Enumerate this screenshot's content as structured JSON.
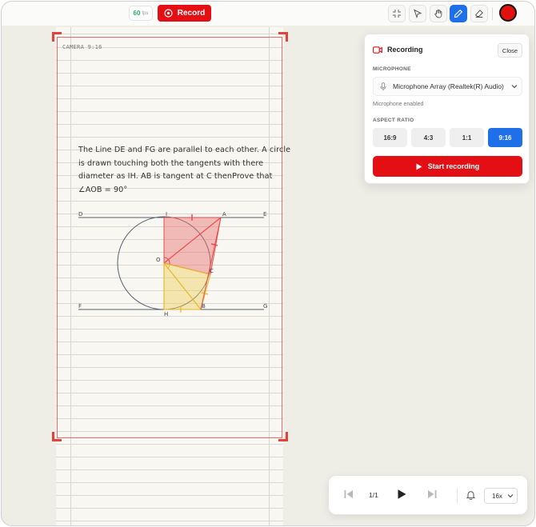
{
  "topbar": {
    "fps_value": "60",
    "fps_unit": "fps",
    "record_label": "Record",
    "tools": [
      {
        "name": "select-crosshair-icon"
      },
      {
        "name": "pointer-icon"
      },
      {
        "name": "hand-icon"
      },
      {
        "name": "pen-icon",
        "active": true
      },
      {
        "name": "eraser-icon"
      }
    ],
    "pen_color": "#e0110f"
  },
  "canvas": {
    "camera_label": "CAMERA 9:16",
    "problem_lines": [
      "The Line DE and FG are parallel to each other. A circle",
      "is drawn touching both the tangents with there",
      "diameter as IH. AB is tangent at C thenProve that",
      "∠AOB = 90°"
    ],
    "points": {
      "D": "D",
      "I": "I",
      "A": "A",
      "E": "E",
      "O": "O",
      "C": "C",
      "F": "F",
      "B": "B",
      "G": "G",
      "H": "H"
    }
  },
  "panel": {
    "title": "Recording",
    "close_label": "Close",
    "microphone_label": "MICROPHONE",
    "microphone_value": "Microphone Array (Realtek(R) Audio)",
    "microphone_status": "Microphone enabled",
    "aspect_label": "ASPECT RATIO",
    "aspect_options": [
      "16:9",
      "4:3",
      "1:1",
      "9:16"
    ],
    "aspect_selected": "9:16",
    "start_label": "Start recording"
  },
  "playback": {
    "page": "1/1",
    "speed": "16x"
  },
  "colors": {
    "accent_blue": "#1f6fe8",
    "record_red": "#e30f14"
  }
}
